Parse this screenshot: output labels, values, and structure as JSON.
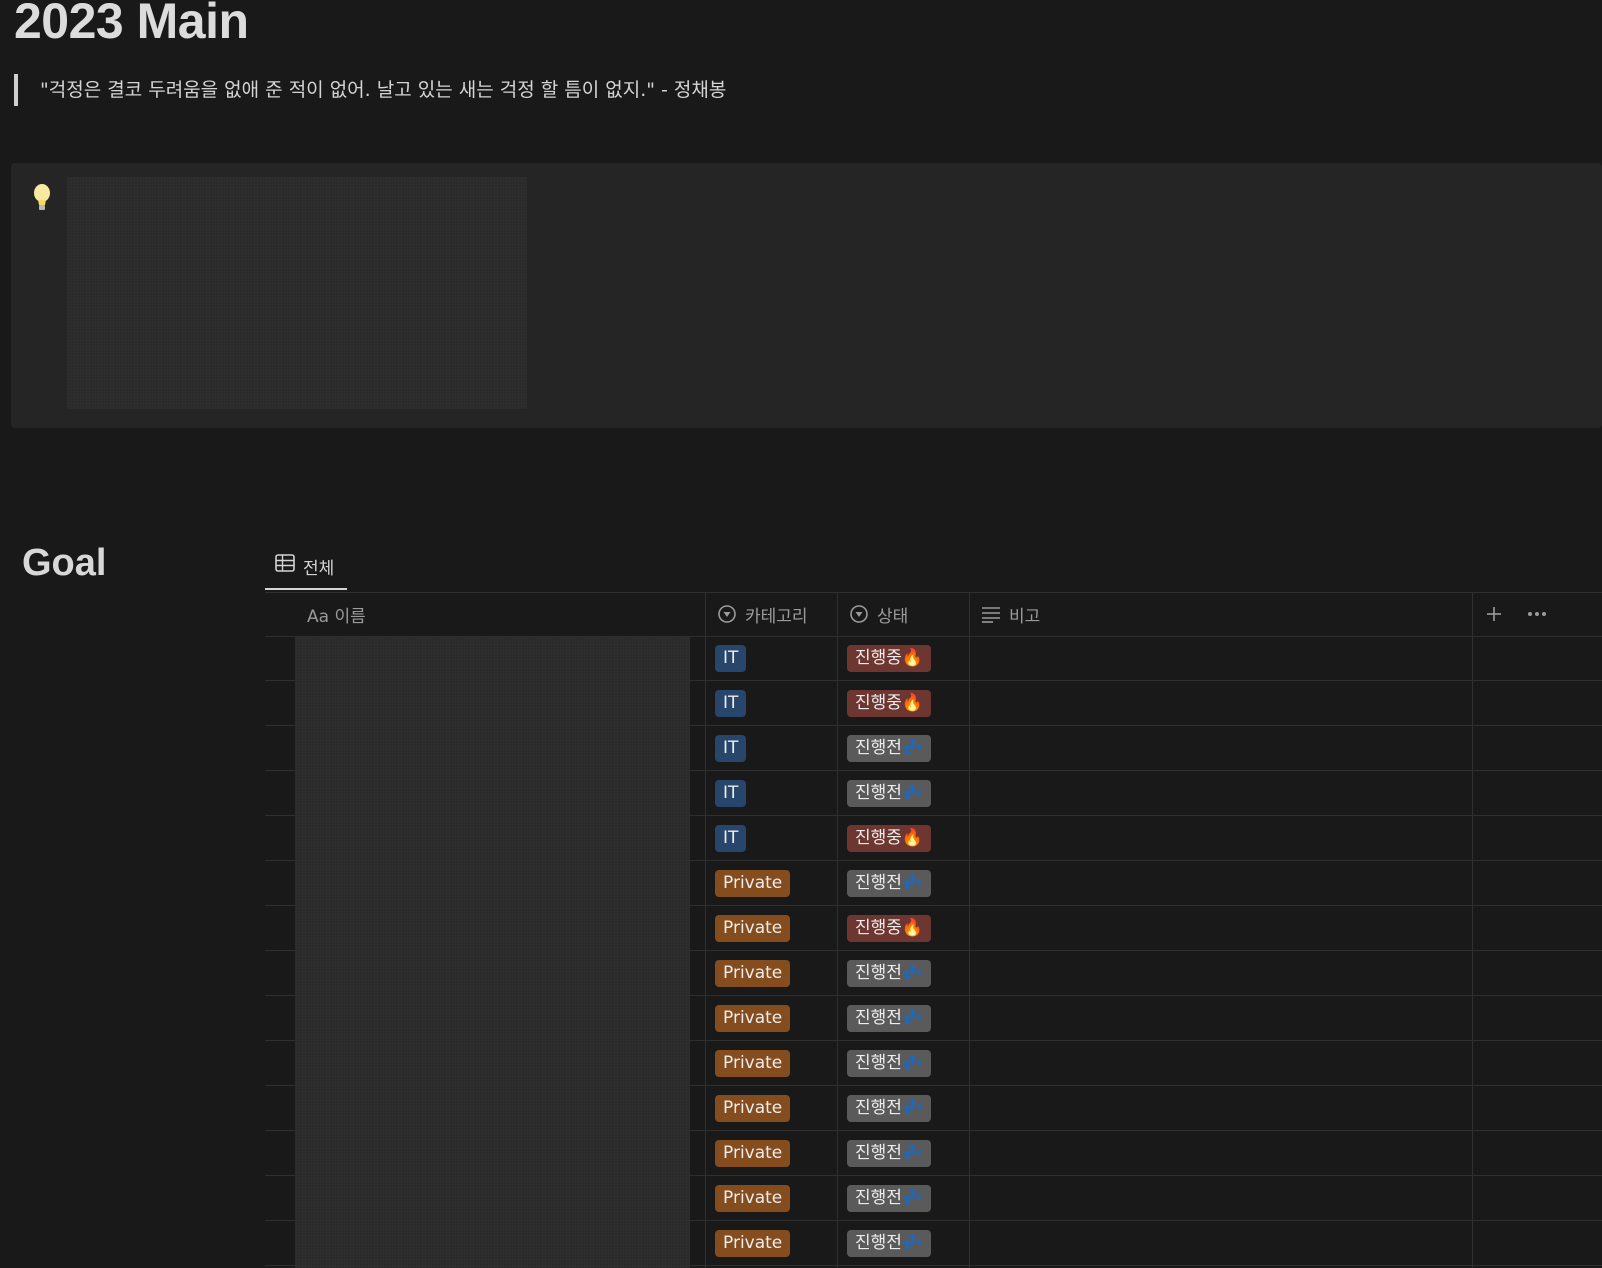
{
  "page": {
    "title": "2023 Main",
    "quote": "\"걱정은 결코 두려움을 없애 준 적이 없어. 날고 있는 새는 걱정 할 틈이 없지.\" - 정채봉"
  },
  "goal": {
    "heading": "Goal",
    "view_tab": "전체",
    "columns": {
      "name": "Aa 이름",
      "category": "카테고리",
      "status": "상태",
      "note": "비고"
    },
    "rows": [
      {
        "category": "IT",
        "status": "진행중🔥"
      },
      {
        "category": "IT",
        "status": "진행중🔥"
      },
      {
        "category": "IT",
        "status": "진행전💤"
      },
      {
        "category": "IT",
        "status": "진행전💤"
      },
      {
        "category": "IT",
        "status": "진행중🔥"
      },
      {
        "category": "Private",
        "status": "진행전💤"
      },
      {
        "category": "Private",
        "status": "진행중🔥"
      },
      {
        "category": "Private",
        "status": "진행전💤"
      },
      {
        "category": "Private",
        "status": "진행전💤"
      },
      {
        "category": "Private",
        "status": "진행전💤"
      },
      {
        "category": "Private",
        "status": "진행전💤"
      },
      {
        "category": "Private",
        "status": "진행전💤"
      },
      {
        "category": "Private",
        "status": "진행전💤"
      },
      {
        "category": "Private",
        "status": "진행전💤"
      }
    ]
  },
  "colors": {
    "background": "#191919",
    "it": "#28456c",
    "private": "#854c1d",
    "in_progress": "#6e3630",
    "not_started": "#5a5a5a"
  }
}
